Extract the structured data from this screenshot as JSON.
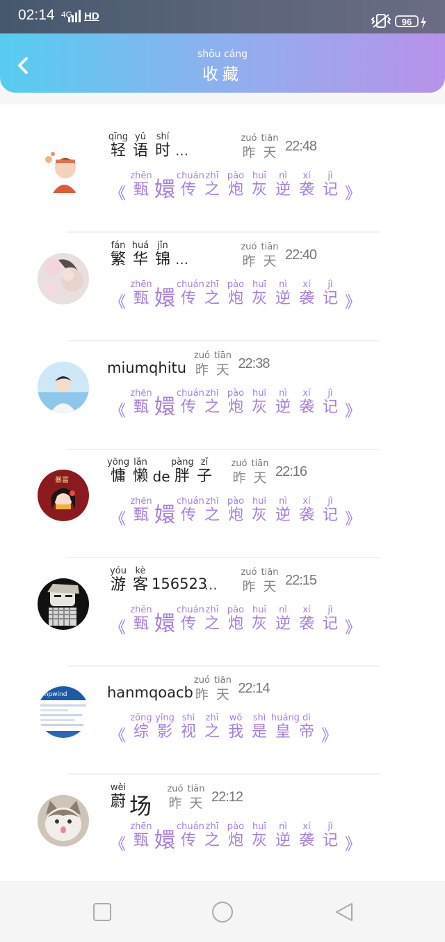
{
  "status_bar": {
    "time": "02:14",
    "signal_label": "4G",
    "hd": "HD",
    "battery": "96",
    "icons": [
      "signal-icon",
      "vibrate-icon",
      "battery-icon",
      "charging-icon"
    ]
  },
  "header": {
    "back_icon": "chevron-left-icon",
    "title_pinyin": "shōu cáng",
    "title": "收藏",
    "gradient": [
      "#56cdf0",
      "#b892ea"
    ]
  },
  "accent_color": "#a77ee0",
  "items": [
    {
      "name_chars": [
        {
          "p": "qīng",
          "c": "轻"
        },
        {
          "p": "yǔ",
          "c": "语"
        },
        {
          "p": "shí",
          "c": "时"
        }
      ],
      "name_latin": "",
      "ellipsis": "…",
      "time_chars": [
        {
          "p": "zuó",
          "c": "昨"
        },
        {
          "p": "tiān",
          "c": "天"
        }
      ],
      "time": "22:48",
      "book": {
        "open": "《",
        "close": "》",
        "chars": [
          {
            "p": "zhēn",
            "c": "甄"
          },
          {
            "p": "",
            "c": "嬛"
          },
          {
            "p": "chuán",
            "c": "传"
          },
          {
            "p": "zhī",
            "c": "之"
          },
          {
            "p": "pào",
            "c": "炮"
          },
          {
            "p": "huī",
            "c": "灰"
          },
          {
            "p": "nì",
            "c": "逆"
          },
          {
            "p": "xí",
            "c": "袭"
          },
          {
            "p": "jì",
            "c": "记"
          }
        ]
      }
    },
    {
      "name_chars": [
        {
          "p": "fán",
          "c": "繁"
        },
        {
          "p": "huá",
          "c": "华"
        },
        {
          "p": "jǐn",
          "c": "锦"
        }
      ],
      "name_latin": "",
      "ellipsis": "…",
      "time_chars": [
        {
          "p": "zuó",
          "c": "昨"
        },
        {
          "p": "tiān",
          "c": "天"
        }
      ],
      "time": "22:40",
      "book": {
        "open": "《",
        "close": "》",
        "chars": [
          {
            "p": "zhēn",
            "c": "甄"
          },
          {
            "p": "",
            "c": "嬛"
          },
          {
            "p": "chuán",
            "c": "传"
          },
          {
            "p": "zhī",
            "c": "之"
          },
          {
            "p": "pào",
            "c": "炮"
          },
          {
            "p": "huī",
            "c": "灰"
          },
          {
            "p": "nì",
            "c": "逆"
          },
          {
            "p": "xí",
            "c": "袭"
          },
          {
            "p": "jì",
            "c": "记"
          }
        ]
      }
    },
    {
      "name_chars": [],
      "name_latin": "miumqhitu",
      "ellipsis": "",
      "time_chars": [
        {
          "p": "zuó",
          "c": "昨"
        },
        {
          "p": "tiān",
          "c": "天"
        }
      ],
      "time": "22:38",
      "book": {
        "open": "《",
        "close": "》",
        "chars": [
          {
            "p": "zhēn",
            "c": "甄"
          },
          {
            "p": "",
            "c": "嬛"
          },
          {
            "p": "chuán",
            "c": "传"
          },
          {
            "p": "zhī",
            "c": "之"
          },
          {
            "p": "pào",
            "c": "炮"
          },
          {
            "p": "huī",
            "c": "灰"
          },
          {
            "p": "nì",
            "c": "逆"
          },
          {
            "p": "xí",
            "c": "袭"
          },
          {
            "p": "jì",
            "c": "记"
          }
        ]
      }
    },
    {
      "name_chars": [
        {
          "p": "yōng",
          "c": "慵"
        },
        {
          "p": "lǎn",
          "c": "懒"
        },
        {
          "p": "",
          "c": "de"
        },
        {
          "p": "pàng",
          "c": "胖"
        },
        {
          "p": "zǐ",
          "c": "子"
        }
      ],
      "name_latin": "",
      "ellipsis": "",
      "time_chars": [
        {
          "p": "zuó",
          "c": "昨"
        },
        {
          "p": "tiān",
          "c": "天"
        }
      ],
      "time": "22:16",
      "book": {
        "open": "《",
        "close": "》",
        "chars": [
          {
            "p": "zhēn",
            "c": "甄"
          },
          {
            "p": "",
            "c": "嬛"
          },
          {
            "p": "chuán",
            "c": "传"
          },
          {
            "p": "zhī",
            "c": "之"
          },
          {
            "p": "pào",
            "c": "炮"
          },
          {
            "p": "huī",
            "c": "灰"
          },
          {
            "p": "nì",
            "c": "逆"
          },
          {
            "p": "xí",
            "c": "袭"
          },
          {
            "p": "jì",
            "c": "记"
          }
        ]
      }
    },
    {
      "name_chars": [
        {
          "p": "yóu",
          "c": "游"
        },
        {
          "p": "kè",
          "c": "客"
        }
      ],
      "name_latin": "156523",
      "ellipsis": "…",
      "time_chars": [
        {
          "p": "zuó",
          "c": "昨"
        },
        {
          "p": "tiān",
          "c": "天"
        }
      ],
      "time": "22:15",
      "book": {
        "open": "《",
        "close": "》",
        "chars": [
          {
            "p": "zhēn",
            "c": "甄"
          },
          {
            "p": "",
            "c": "嬛"
          },
          {
            "p": "chuán",
            "c": "传"
          },
          {
            "p": "zhī",
            "c": "之"
          },
          {
            "p": "pào",
            "c": "炮"
          },
          {
            "p": "huī",
            "c": "灰"
          },
          {
            "p": "nì",
            "c": "逆"
          },
          {
            "p": "xí",
            "c": "袭"
          },
          {
            "p": "jì",
            "c": "记"
          }
        ]
      }
    },
    {
      "name_chars": [],
      "name_latin": "hanmqoacb",
      "ellipsis": "",
      "time_chars": [
        {
          "p": "zuó",
          "c": "昨"
        },
        {
          "p": "tiān",
          "c": "天"
        }
      ],
      "time": "22:14",
      "book": {
        "open": "《",
        "close": "》",
        "chars": [
          {
            "p": "zōng",
            "c": "综"
          },
          {
            "p": "yǐng",
            "c": "影"
          },
          {
            "p": "shì",
            "c": "视"
          },
          {
            "p": "zhī",
            "c": "之"
          },
          {
            "p": "wǒ",
            "c": "我"
          },
          {
            "p": "shì",
            "c": "是"
          },
          {
            "p": "huáng",
            "c": "皇"
          },
          {
            "p": "dì",
            "c": "帝"
          }
        ]
      }
    },
    {
      "name_chars": [
        {
          "p": "wèi",
          "c": "蔚"
        },
        {
          "p": "",
          "c": "场"
        }
      ],
      "name_latin": "",
      "ellipsis": "",
      "time_chars": [
        {
          "p": "zuó",
          "c": "昨"
        },
        {
          "p": "tiān",
          "c": "天"
        }
      ],
      "time": "22:12",
      "book": {
        "open": "《",
        "close": "》",
        "chars": [
          {
            "p": "zhēn",
            "c": "甄"
          },
          {
            "p": "",
            "c": "嬛"
          },
          {
            "p": "chuán",
            "c": "传"
          },
          {
            "p": "zhī",
            "c": "之"
          },
          {
            "p": "pào",
            "c": "炮"
          },
          {
            "p": "huī",
            "c": "灰"
          },
          {
            "p": "nì",
            "c": "逆"
          },
          {
            "p": "xí",
            "c": "袭"
          },
          {
            "p": "jì",
            "c": "记"
          }
        ]
      }
    }
  ],
  "avatars": [
    "avatar-boy-cartoon",
    "avatar-girl-flowers",
    "avatar-boy-sky",
    "avatar-red-girl",
    "avatar-cartoon-man",
    "avatar-phpwind-screenshot",
    "avatar-cat"
  ],
  "nav": {
    "icons": [
      "recent-apps-icon",
      "home-icon",
      "back-icon"
    ]
  }
}
